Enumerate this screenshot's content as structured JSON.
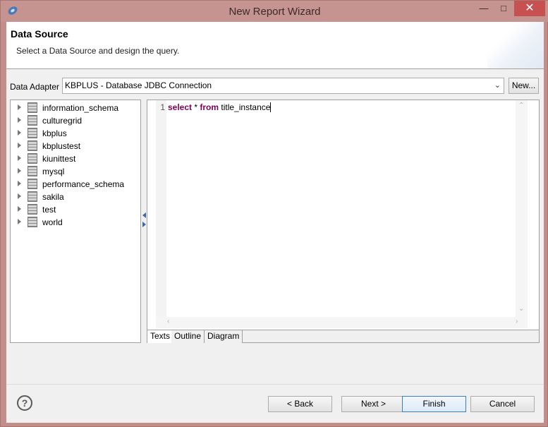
{
  "window": {
    "title": "New Report Wizard",
    "controls": {
      "minimize": "—",
      "maximize": "□",
      "close": "✕"
    }
  },
  "header": {
    "title": "Data Source",
    "description": "Select a Data Source and design the query."
  },
  "adapter": {
    "label": "Data Adapter",
    "selected": "KBPLUS - Database JDBC Connection",
    "new_button": "New..."
  },
  "tree": {
    "items": [
      {
        "label": "information_schema"
      },
      {
        "label": "culturegrid"
      },
      {
        "label": "kbplus"
      },
      {
        "label": "kbplustest"
      },
      {
        "label": "kiunittest"
      },
      {
        "label": "mysql"
      },
      {
        "label": "performance_schema"
      },
      {
        "label": "sakila"
      },
      {
        "label": "test"
      },
      {
        "label": "world"
      }
    ]
  },
  "editor": {
    "line_number": "1",
    "code": {
      "kw1": "select",
      "mid": " * ",
      "kw2": "from",
      "rest": " title_instance"
    },
    "tabs": [
      "Texts",
      "Outline",
      "Diagram"
    ]
  },
  "footer": {
    "help": "?",
    "back": "< Back",
    "next": "Next >",
    "finish": "Finish",
    "cancel": "Cancel"
  },
  "colors": {
    "window_frame": "#c38e89",
    "keyword": "#7f0055",
    "close_button": "#c75050",
    "focus_border": "#3c7fb1"
  },
  "icons": [
    "app-icon",
    "database-icon",
    "expand-arrow-icon",
    "help-icon",
    "chevron-down-icon"
  ]
}
